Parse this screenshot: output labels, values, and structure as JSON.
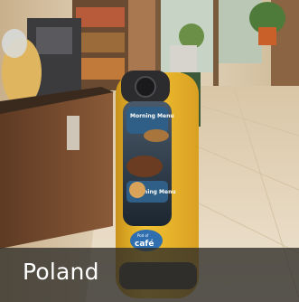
{
  "caption": {
    "country": "Poland"
  },
  "robot_screen": {
    "line1": "Morning Menu",
    "line2": "Morning Menu"
  },
  "robot_logo": {
    "small": "Pod of",
    "main": "café"
  },
  "colors": {
    "robot_body": "#e9b424",
    "caption_overlay": "#2d2b28",
    "floor": "#e3d3b8",
    "counter_wood": "#7a4a2d"
  }
}
